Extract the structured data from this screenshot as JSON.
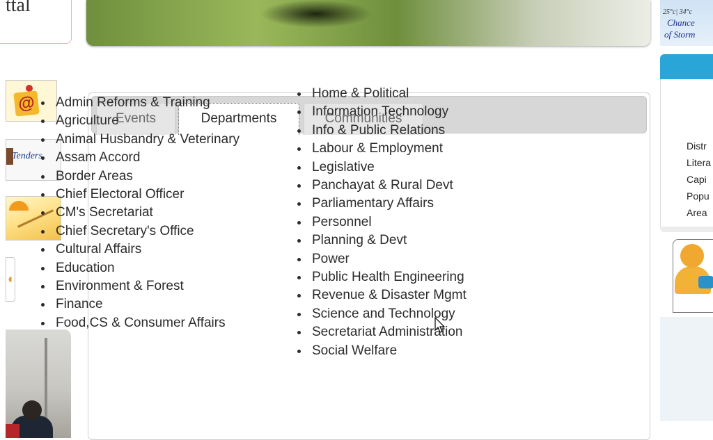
{
  "left": {
    "top_text": "ttal",
    "tenders_label": "Tenders",
    "small_glyph": "◐"
  },
  "weather": {
    "temp": "25°c| 34°c",
    "line1": "Chance",
    "line2": "of Storm"
  },
  "tabs": [
    {
      "label": "Events",
      "active": false
    },
    {
      "label": "Departments",
      "active": true
    },
    {
      "label": "Communities",
      "active": false
    }
  ],
  "departments": {
    "column1": [
      "Admin Reforms & Training",
      "Agriculture",
      "Animal Husbandry & Veterinary",
      "Assam Accord",
      "Border Areas",
      "Chief Electoral Officer",
      "CM's Secretariat",
      "Chief Secretary's Office",
      "Cultural Affairs",
      "Education",
      "Environment & Forest",
      "Finance",
      "Food,CS & Consumer Affairs"
    ],
    "column2": [
      "Home & Political",
      "Information Technology",
      "Info & Public Relations",
      "Labour & Employment",
      "Legislative",
      "Panchayat & Rural Devt",
      "Parliamentary Affairs",
      "Personnel",
      "Planning & Devt",
      "Power",
      "Public Health Engineering",
      "Revenue & Disaster Mgmt",
      "Science and Technology",
      "Secretariat Administration",
      "Social Welfare"
    ]
  },
  "info_labels": [
    "Distr",
    "Litera",
    "Capi",
    "Popu",
    "Area"
  ],
  "icons": {
    "mail": "mail-at-icon",
    "cursor": "mouse-cursor-icon"
  }
}
